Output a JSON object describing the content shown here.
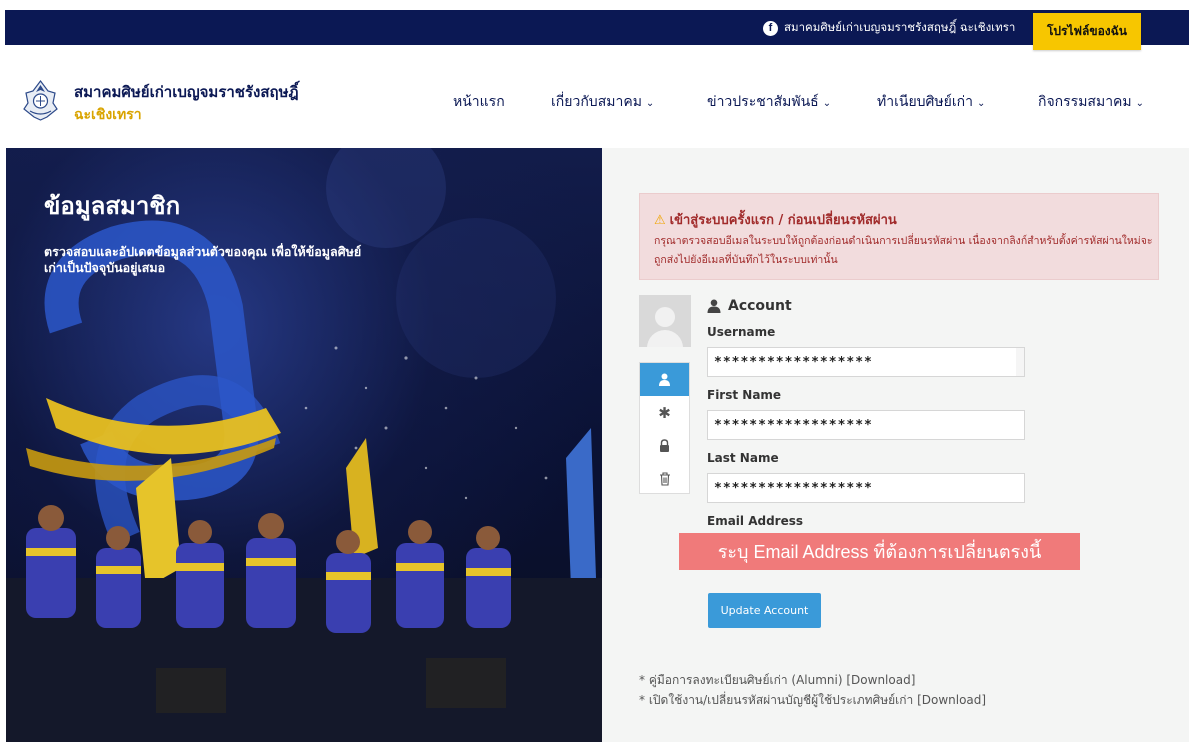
{
  "topbar": {
    "facebook_text": "สมาคมศิษย์เก่าเบญจมราชรังสฤษฎิ์ ฉะเชิงเทรา",
    "profile_button": "โปรไฟล์ของฉัน"
  },
  "header": {
    "brand_line1": "สมาคมศิษย์เก่าเบญจมราชรังสฤษฎิ์",
    "brand_line2": "ฉะเชิงเทรา",
    "nav": [
      {
        "label": "หน้าแรก",
        "dropdown": false
      },
      {
        "label": "เกี่ยวกับสมาคม",
        "dropdown": true
      },
      {
        "label": "ข่าวประชาสัมพันธ์",
        "dropdown": true
      },
      {
        "label": "ทำเนียบศิษย์เก่า",
        "dropdown": true
      },
      {
        "label": "กิจกรรมสมาคม",
        "dropdown": true
      }
    ]
  },
  "hero": {
    "title": "ข้อมูลสมาชิก",
    "subtitle": "ตรวจสอบและอัปเดตข้อมูลส่วนตัวของคุณ เพื่อให้ข้อมูลศิษย์เก่าเป็นปัจจุบันอยู่เสมอ"
  },
  "alert": {
    "title": "เข้าสู่ระบบครั้งแรก / ก่อนเปลี่ยนรหัสผ่าน",
    "body": "กรุณาตรวจสอบอีเมลในระบบให้ถูกต้องก่อนดำเนินการเปลี่ยนรหัสผ่าน เนื่องจากลิงก์สำหรับตั้งค่ารหัสผ่านใหม่จะถูกส่งไปยังอีเมลที่บันทึกไว้ในระบบเท่านั้น"
  },
  "account": {
    "title": "Account",
    "username_label": "Username",
    "username_value": "******************",
    "firstname_label": "First Name",
    "firstname_value": "******************",
    "lastname_label": "Last Name",
    "lastname_value": "******************",
    "email_label": "Email Address",
    "email_hint": "ระบุ Email Address ที่ต้องการเปลี่ยนตรงนี้",
    "update_button": "Update Account"
  },
  "notes": [
    "* คู่มือการลงทะเบียนศิษย์เก่า (Alumni) [Download]",
    "* เปิดใช้งาน/เปลี่ยนรหัสผ่านบัญชีผู้ใช้ประเภทศิษย์เก่า  [Download]"
  ],
  "colors": {
    "navy": "#0b1854",
    "gold": "#f7c600",
    "primary_blue": "#3a9ad9",
    "alert_bg": "#f2dcdd",
    "hint_red": "#f07a7a"
  }
}
